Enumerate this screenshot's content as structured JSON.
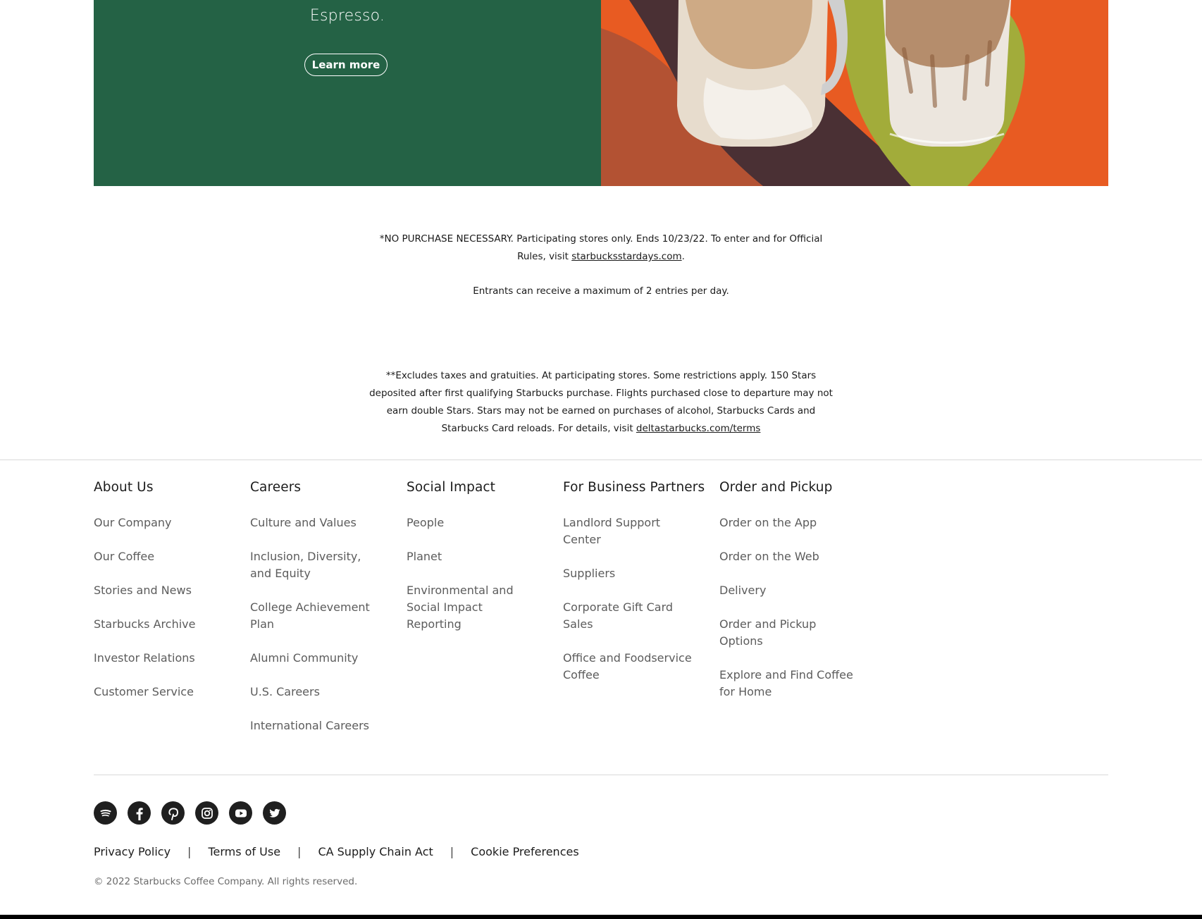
{
  "hero": {
    "text": "Espresso.",
    "button_label": "Learn more"
  },
  "disclaimers": {
    "purchase_text": "*NO PURCHASE NECESSARY. Participating stores only. Ends 10/23/22. To enter and for Official Rules, visit ",
    "purchase_link": "starbucksstardays.com",
    "purchase_end": ".",
    "entries_text": "Entrants can receive a maximum of 2 entries per day.",
    "delta_text": "**Excludes taxes and gratuities. At participating stores. Some restrictions apply. 150 Stars deposited after first qualifying Starbucks purchase. Flights purchased close to departure may not earn double Stars. Stars may not be earned on purchases of alcohol, Starbucks Cards and Starbucks Card reloads. For details, visit ",
    "delta_link": "deltastarbucks.com/terms"
  },
  "footer": {
    "columns": [
      {
        "heading": "About Us",
        "links": [
          "Our Company",
          "Our Coffee",
          "Stories and News",
          "Starbucks Archive",
          "Investor Relations",
          "Customer Service"
        ]
      },
      {
        "heading": "Careers",
        "links": [
          "Culture and Values",
          "Inclusion, Diversity, and Equity",
          "College Achievement Plan",
          "Alumni Community",
          "U.S. Careers",
          "International Careers"
        ]
      },
      {
        "heading": "Social Impact",
        "links": [
          "People",
          "Planet",
          "Environmental and Social Impact Reporting"
        ]
      },
      {
        "heading": "For Business Partners",
        "links": [
          "Landlord Support Center",
          "Suppliers",
          "Corporate Gift Card Sales",
          "Office and Foodservice Coffee"
        ]
      },
      {
        "heading": "Order and Pickup",
        "links": [
          "Order on the App",
          "Order on the Web",
          "Delivery",
          "Order and Pickup Options",
          "Explore and Find Coffee for Home"
        ]
      }
    ],
    "social_icons": [
      "spotify-icon",
      "facebook-icon",
      "pinterest-icon",
      "instagram-icon",
      "youtube-icon",
      "twitter-icon"
    ],
    "legal": {
      "privacy": "Privacy Policy",
      "terms": "Terms of Use",
      "ca_supply": "CA Supply Chain Act",
      "cookies": "Cookie Preferences",
      "separator": "|"
    },
    "copyright": "© 2022 Starbucks Coffee Company. All rights reserved."
  },
  "colors": {
    "hero_green": "#246245",
    "hero_orange": "#e85b22",
    "hero_olive": "#a2ac3a",
    "hero_brown": "#4a3034"
  }
}
